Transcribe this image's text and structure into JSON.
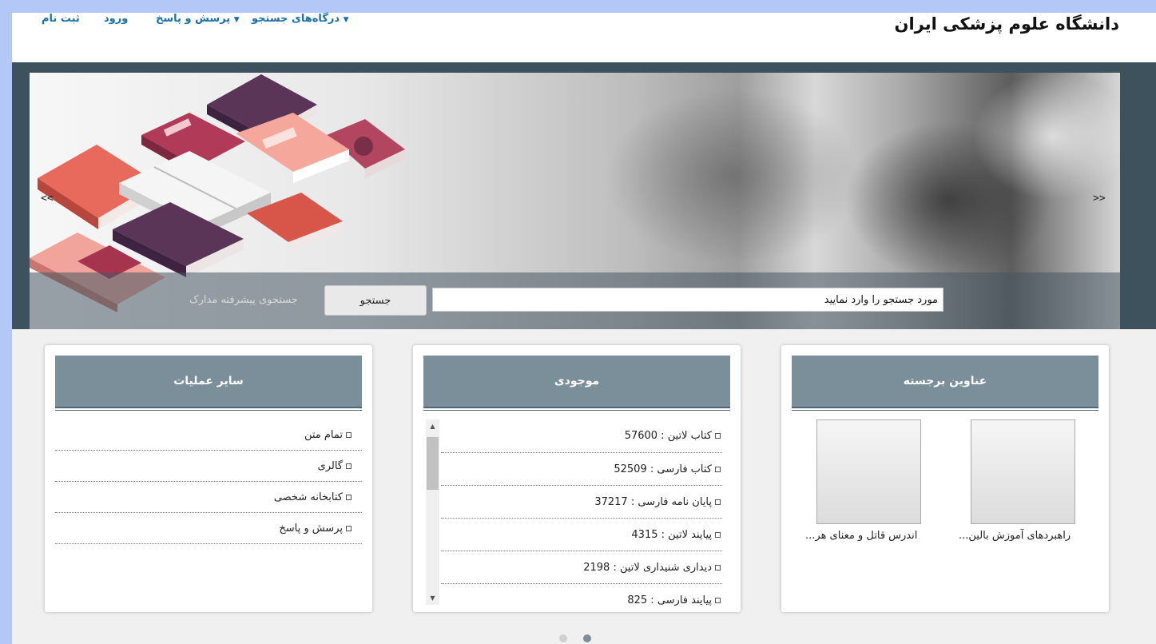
{
  "header": {
    "site_title": "دانشگاه علوم پزشکی ایران",
    "nav": {
      "search_portals": "درگاه‌های جستجو",
      "qa": "پرسش و پاسخ",
      "login": "ورود",
      "register": "ثبت نام"
    }
  },
  "hero": {
    "prev_arrow": "<<",
    "next_arrow": ">>",
    "search": {
      "placeholder": "مورد جستجو را وارد نمایید",
      "value": "مورد جستجو را وارد نمایید",
      "button_label": "جستجو",
      "advanced_link": "جستجوی پیشرفته مدارک"
    }
  },
  "featured": {
    "title": "عناوین برجسته",
    "items": [
      {
        "caption": "راهبردهای آموزش بالین..."
      },
      {
        "caption": "اندرس قاتل و معنای هر..."
      }
    ]
  },
  "inventory": {
    "title": "موجودی",
    "items": [
      {
        "label": "کتاب لاتین : 57600"
      },
      {
        "label": "کتاب فارسی : 52509"
      },
      {
        "label": "پایان نامه فارسی : 37217"
      },
      {
        "label": "پیایند لاتین : 4315"
      },
      {
        "label": "دیداری شنیداری لاتین : 2198"
      },
      {
        "label": "پیایند فارسی : 825"
      }
    ]
  },
  "other_ops": {
    "title": "سایر عملیات",
    "items": [
      {
        "label": "تمام متن"
      },
      {
        "label": "گالری"
      },
      {
        "label": "کتابخانه شخصی"
      },
      {
        "label": "پرسش و پاسخ"
      }
    ]
  },
  "carousel": {
    "active_page": 2,
    "total_pages": 2
  },
  "colors": {
    "nav_link": "#1a6fa8",
    "panel_header": "#7a8f99",
    "hero_bg": "#3d525c",
    "outer_frame": "#b3c8f7"
  },
  "icons": [
    "caret-down-icon",
    "square-bullet-icon",
    "scroll-up-icon",
    "scroll-down-icon"
  ]
}
